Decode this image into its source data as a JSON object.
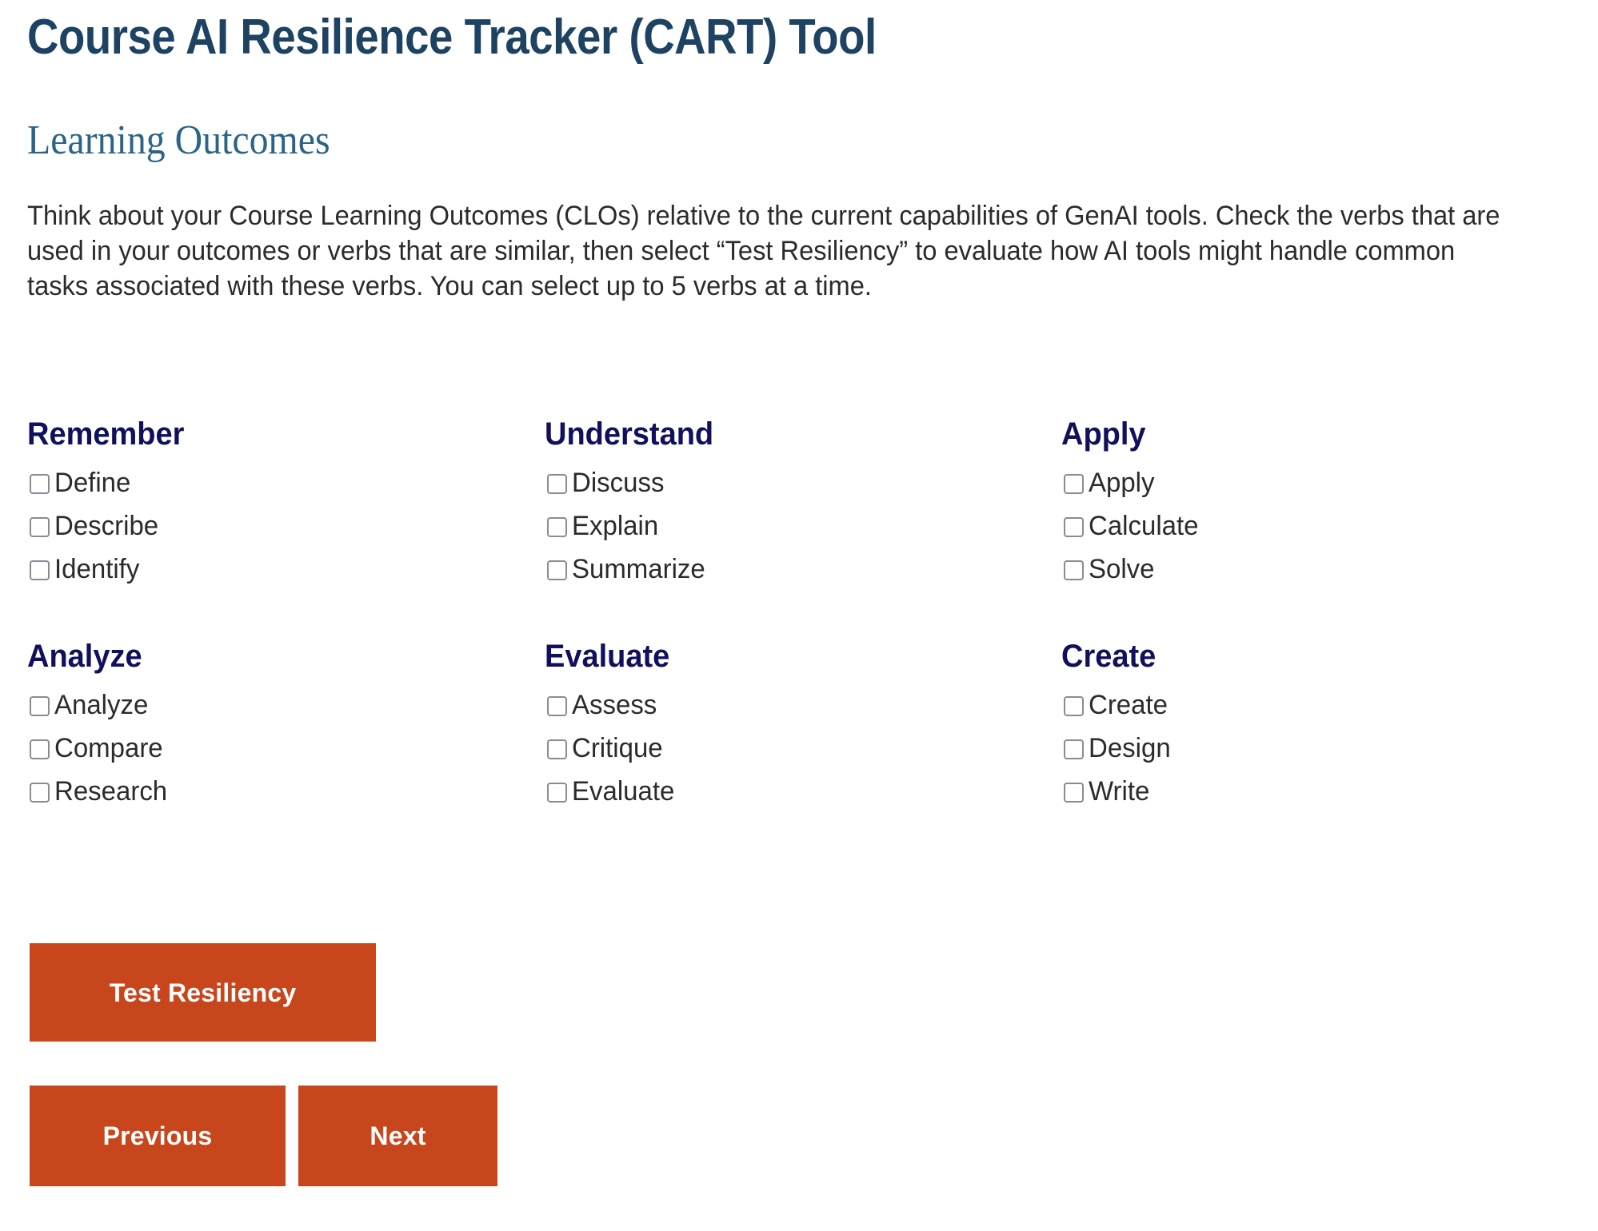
{
  "app": {
    "title": "Course AI Resilience Tracker (CART) Tool"
  },
  "section": {
    "heading": "Learning Outcomes",
    "intro": "Think about your Course Learning Outcomes (CLOs) relative to the current capabilities of GenAI tools. Check the verbs that are used in your outcomes or verbs that are similar, then select “Test Resiliency” to evaluate how AI tools might handle common tasks associated with these verbs. You can select up to 5 verbs at a time."
  },
  "colors": {
    "title": "#1D4262",
    "section_heading": "#2A6587",
    "group_heading": "#10105C",
    "button": "#C8461C",
    "button_text": "#FFFFFF",
    "body_text": "#2B2B2B",
    "checkbox_border": "#8B8B96",
    "background": "#FFFFFF"
  },
  "verb_groups": [
    {
      "heading": "Remember",
      "verbs": [
        {
          "label": "Define",
          "checked": false
        },
        {
          "label": "Describe",
          "checked": false
        },
        {
          "label": "Identify",
          "checked": false
        }
      ]
    },
    {
      "heading": "Understand",
      "verbs": [
        {
          "label": "Discuss",
          "checked": false
        },
        {
          "label": "Explain",
          "checked": false
        },
        {
          "label": "Summarize",
          "checked": false
        }
      ]
    },
    {
      "heading": "Apply",
      "verbs": [
        {
          "label": "Apply",
          "checked": false
        },
        {
          "label": "Calculate",
          "checked": false
        },
        {
          "label": "Solve",
          "checked": false
        }
      ]
    },
    {
      "heading": "Analyze",
      "verbs": [
        {
          "label": "Analyze",
          "checked": false
        },
        {
          "label": "Compare",
          "checked": false
        },
        {
          "label": "Research",
          "checked": false
        }
      ]
    },
    {
      "heading": "Evaluate",
      "verbs": [
        {
          "label": "Assess",
          "checked": false
        },
        {
          "label": "Critique",
          "checked": false
        },
        {
          "label": "Evaluate",
          "checked": false
        }
      ]
    },
    {
      "heading": "Create",
      "verbs": [
        {
          "label": "Create",
          "checked": false
        },
        {
          "label": "Design",
          "checked": false
        },
        {
          "label": "Write",
          "checked": false
        }
      ]
    }
  ],
  "buttons": {
    "test_resiliency": "Test Resiliency",
    "previous": "Previous",
    "next": "Next"
  },
  "limits": {
    "max_verbs": 5
  }
}
